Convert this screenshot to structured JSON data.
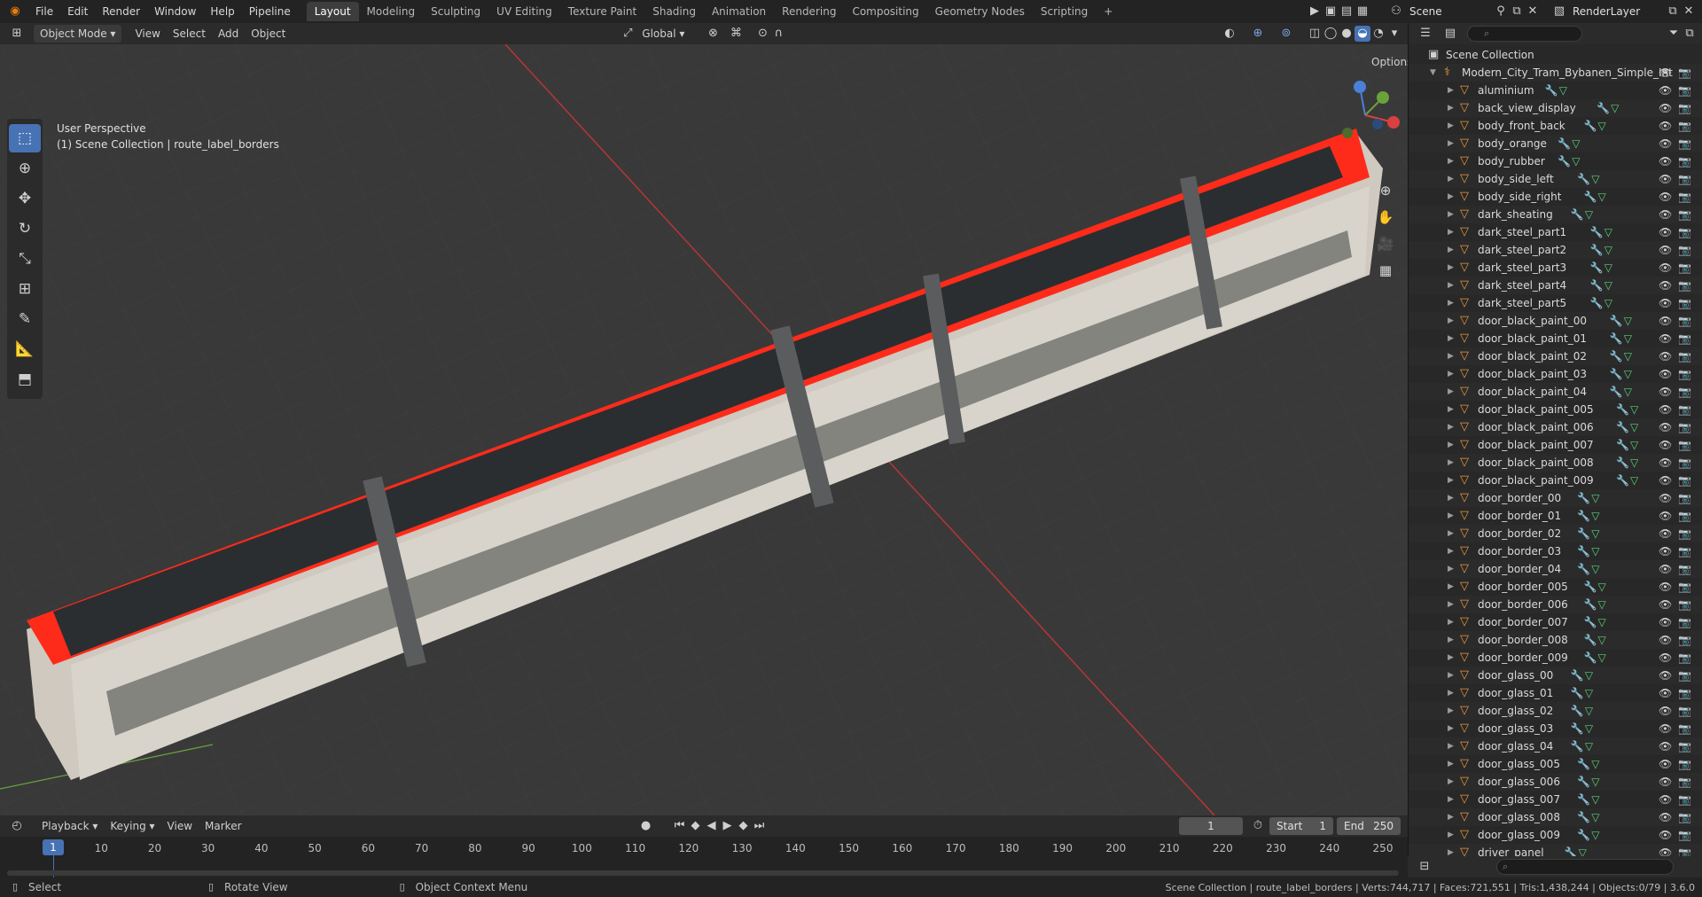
{
  "menus": [
    "File",
    "Edit",
    "Render",
    "Window",
    "Help",
    "Pipeline"
  ],
  "workspaces": [
    "Layout",
    "Modeling",
    "Sculpting",
    "UV Editing",
    "Texture Paint",
    "Shading",
    "Animation",
    "Rendering",
    "Compositing",
    "Geometry Nodes",
    "Scripting"
  ],
  "active_workspace": "Layout",
  "scene_name": "Scene",
  "view_layer": "RenderLayer",
  "viewport": {
    "mode": "Object Mode",
    "menus": [
      "View",
      "Select",
      "Add",
      "Object"
    ],
    "transform_orientation": "Global",
    "options_label": "Options",
    "info_line1": "User Perspective",
    "info_line2": "(1) Scene Collection | route_label_borders"
  },
  "outliner": {
    "root": "Scene Collection",
    "collection": "Modern_City_Tram_Bybanen_Simple_Int",
    "items": [
      "aluminium",
      "back_view_display",
      "body_front_back",
      "body_orange",
      "body_rubber",
      "body_side_left",
      "body_side_right",
      "dark_sheating",
      "dark_steel_part1",
      "dark_steel_part2",
      "dark_steel_part3",
      "dark_steel_part4",
      "dark_steel_part5",
      "door_black_paint_00",
      "door_black_paint_01",
      "door_black_paint_02",
      "door_black_paint_03",
      "door_black_paint_04",
      "door_black_paint_005",
      "door_black_paint_006",
      "door_black_paint_007",
      "door_black_paint_008",
      "door_black_paint_009",
      "door_border_00",
      "door_border_01",
      "door_border_02",
      "door_border_03",
      "door_border_04",
      "door_border_005",
      "door_border_006",
      "door_border_007",
      "door_border_008",
      "door_border_009",
      "door_glass_00",
      "door_glass_01",
      "door_glass_02",
      "door_glass_03",
      "door_glass_04",
      "door_glass_005",
      "door_glass_006",
      "door_glass_007",
      "door_glass_008",
      "door_glass_009",
      "driver_panel"
    ]
  },
  "timeline": {
    "menus": [
      "Playback",
      "Keying",
      "View",
      "Marker"
    ],
    "current_frame": "1",
    "start_label": "Start",
    "start": "1",
    "end_label": "End",
    "end": "250",
    "ticks": [
      "1",
      "10",
      "20",
      "30",
      "40",
      "50",
      "60",
      "70",
      "80",
      "90",
      "100",
      "110",
      "120",
      "130",
      "140",
      "150",
      "160",
      "170",
      "180",
      "190",
      "200",
      "210",
      "220",
      "230",
      "240",
      "250"
    ]
  },
  "status": {
    "select": "Select",
    "rotate": "Rotate View",
    "context": "Object Context Menu",
    "stats": "Scene Collection | route_label_borders | Verts:744,717 | Faces:721,551 | Tris:1,438,244 | Objects:0/79 | 3.6.0"
  },
  "colors": {
    "accent": "#4772b3",
    "tram_red": "#ff2b1a",
    "object_icon": "#e8963c",
    "modifier_icon": "#6a9de0",
    "mesh_icon": "#5ad17a"
  }
}
